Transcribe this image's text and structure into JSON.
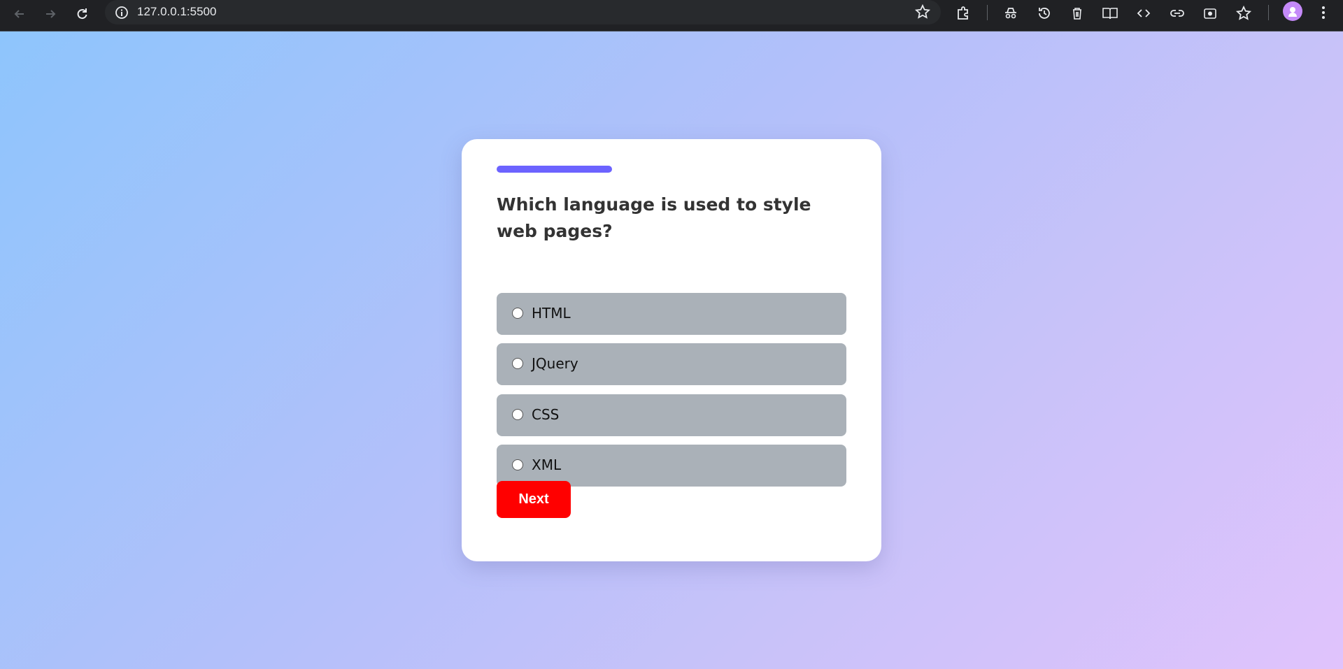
{
  "browser": {
    "url": "127.0.0.1:5500",
    "icons": {
      "back": "arrow-left",
      "forward": "arrow-right",
      "reload": "reload",
      "site_info": "info-circle",
      "bookmark": "star-outline",
      "extensions": "puzzle",
      "incognito": "incognito",
      "history": "history",
      "delete": "trash",
      "reading_mode": "book",
      "devtools": "code-brackets",
      "link": "link",
      "screenshot": "camera",
      "favorites": "star-outline",
      "profile": "avatar",
      "menu": "three-dots"
    }
  },
  "quiz": {
    "progress_fraction": 0.33,
    "progress_color": "#6c63ff",
    "question": "Which language is used to style web pages?",
    "options": [
      {
        "label": "HTML",
        "selected": false
      },
      {
        "label": "JQuery",
        "selected": false
      },
      {
        "label": "CSS",
        "selected": false
      },
      {
        "label": "XML",
        "selected": false
      }
    ],
    "next_label": "Next",
    "next_color": "#ff0000",
    "option_bg": "#aab1b8"
  }
}
